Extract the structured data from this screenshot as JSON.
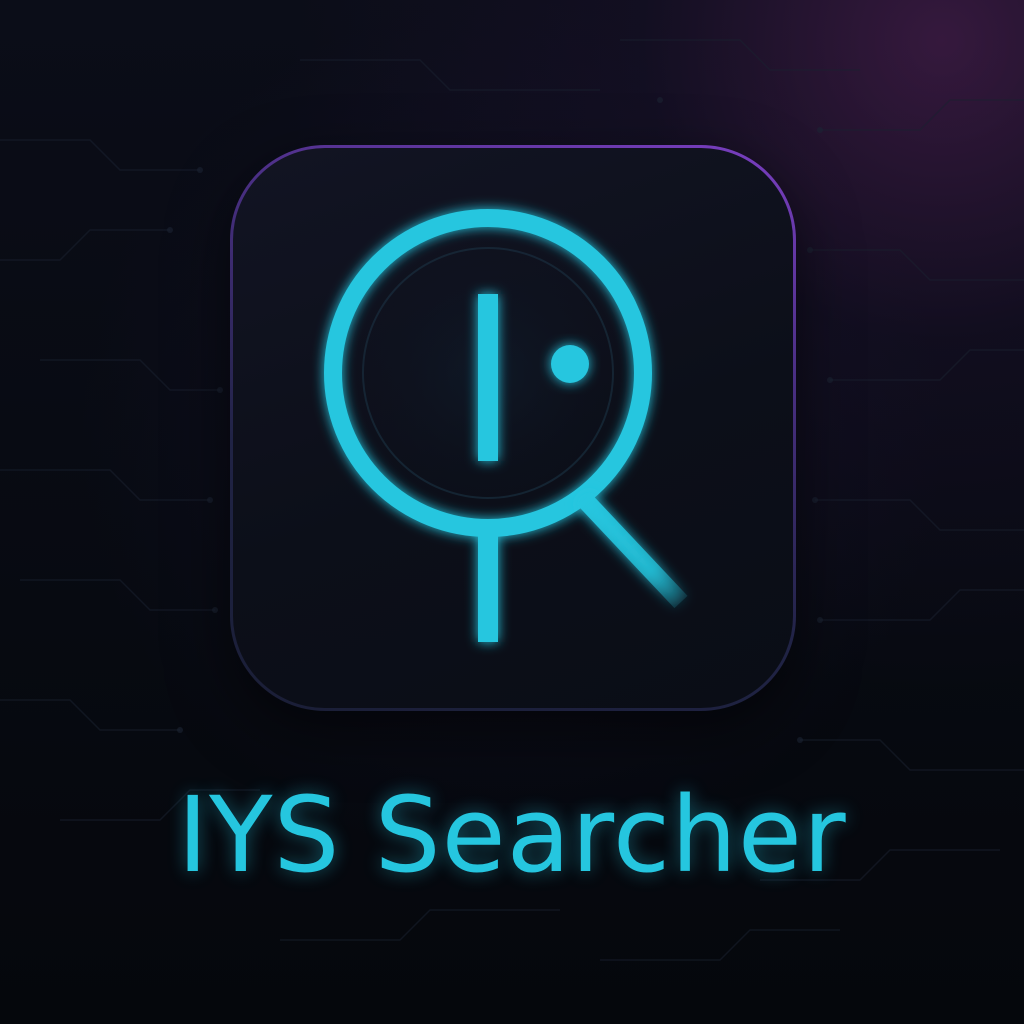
{
  "app": {
    "name": "IYS Searcher",
    "icon": "magnifying-glass-with-i-and-dot"
  },
  "colors": {
    "accent": "#25c6df",
    "background": "#070a10",
    "tile": "#0f121e",
    "border_glow": "#7b3fc2"
  }
}
